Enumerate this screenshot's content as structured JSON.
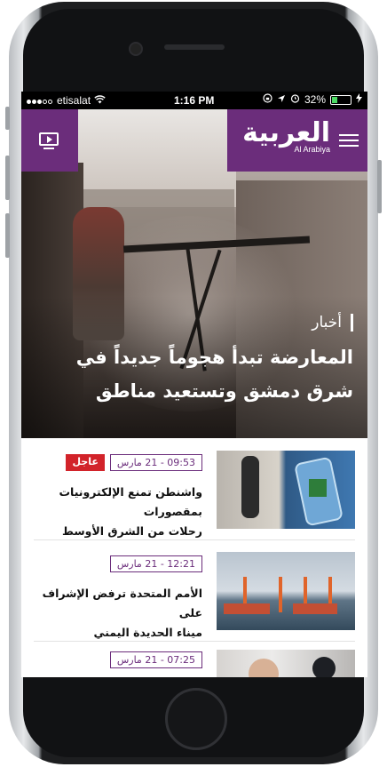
{
  "status_bar": {
    "carrier": "etisalat",
    "time": "1:16 PM",
    "battery_percent": "32%",
    "battery_level": 0.32
  },
  "header": {
    "brand_arabic": "العربية",
    "brand_english": "Al Arabiya",
    "accent_color": "#6b2d7b"
  },
  "hero": {
    "category": "أخبار",
    "headline_line1": "المعارضة تبدأ هجوماً جديداً في",
    "headline_line2": "شرق دمشق وتستعيد مناطق"
  },
  "news": [
    {
      "date": "09:53 - 21 مارس",
      "badge": "عاجل",
      "title_line1": "واشنطن تمنع الإلكترونيات بمقصورات",
      "title_line2": "رحلات من الشرق الأوسط"
    },
    {
      "date": "12:21 - 21 مارس",
      "title_line1": "الأمم المتحدة ترفض الإشراف على",
      "title_line2": "ميناء الحديدة اليمني"
    },
    {
      "date": "07:25 - 21 مارس"
    }
  ]
}
